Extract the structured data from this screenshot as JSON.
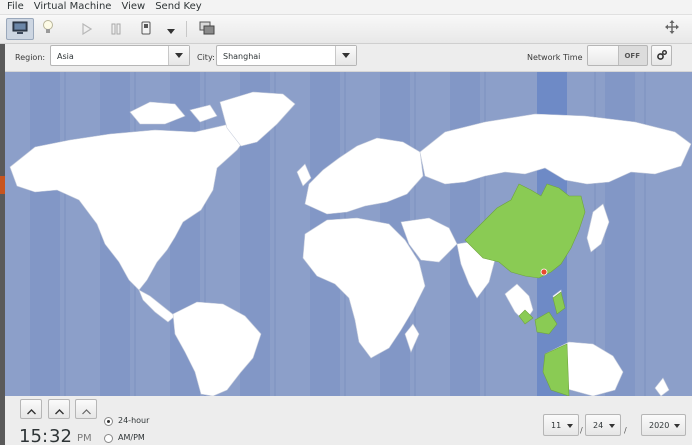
{
  "menubar": {
    "items": [
      "File",
      "Virtual Machine",
      "View",
      "Send Key"
    ]
  },
  "toolbar": {
    "icons": [
      "display-icon",
      "lightbulb-icon",
      "play-icon",
      "pause-icon",
      "power-icon",
      "chevron-down-icon",
      "snapshots-icon",
      "fullscreen-icon"
    ]
  },
  "datetime": {
    "region_label": "Region:",
    "region_value": "Asia",
    "city_label": "City:",
    "city_value": "Shanghai",
    "network_time_label": "Network Time",
    "network_time_state": "OFF"
  },
  "clock": {
    "hours": "15",
    "separator": ":",
    "minutes": "32",
    "ampm": "PM",
    "format_24_label": "24-hour",
    "format_ampm_label": "AM/PM",
    "selected_format": "24-hour"
  },
  "date": {
    "month": "11",
    "day": "24",
    "year": "2020",
    "separator": "/"
  },
  "colors": {
    "ocean": "#8c9fc9",
    "timezone_band": "#7d92c2",
    "selected_band": "#6e8ac6",
    "land": "#ffffff",
    "selected_zone": "#8acb54",
    "city_marker": "#e84a2d"
  }
}
